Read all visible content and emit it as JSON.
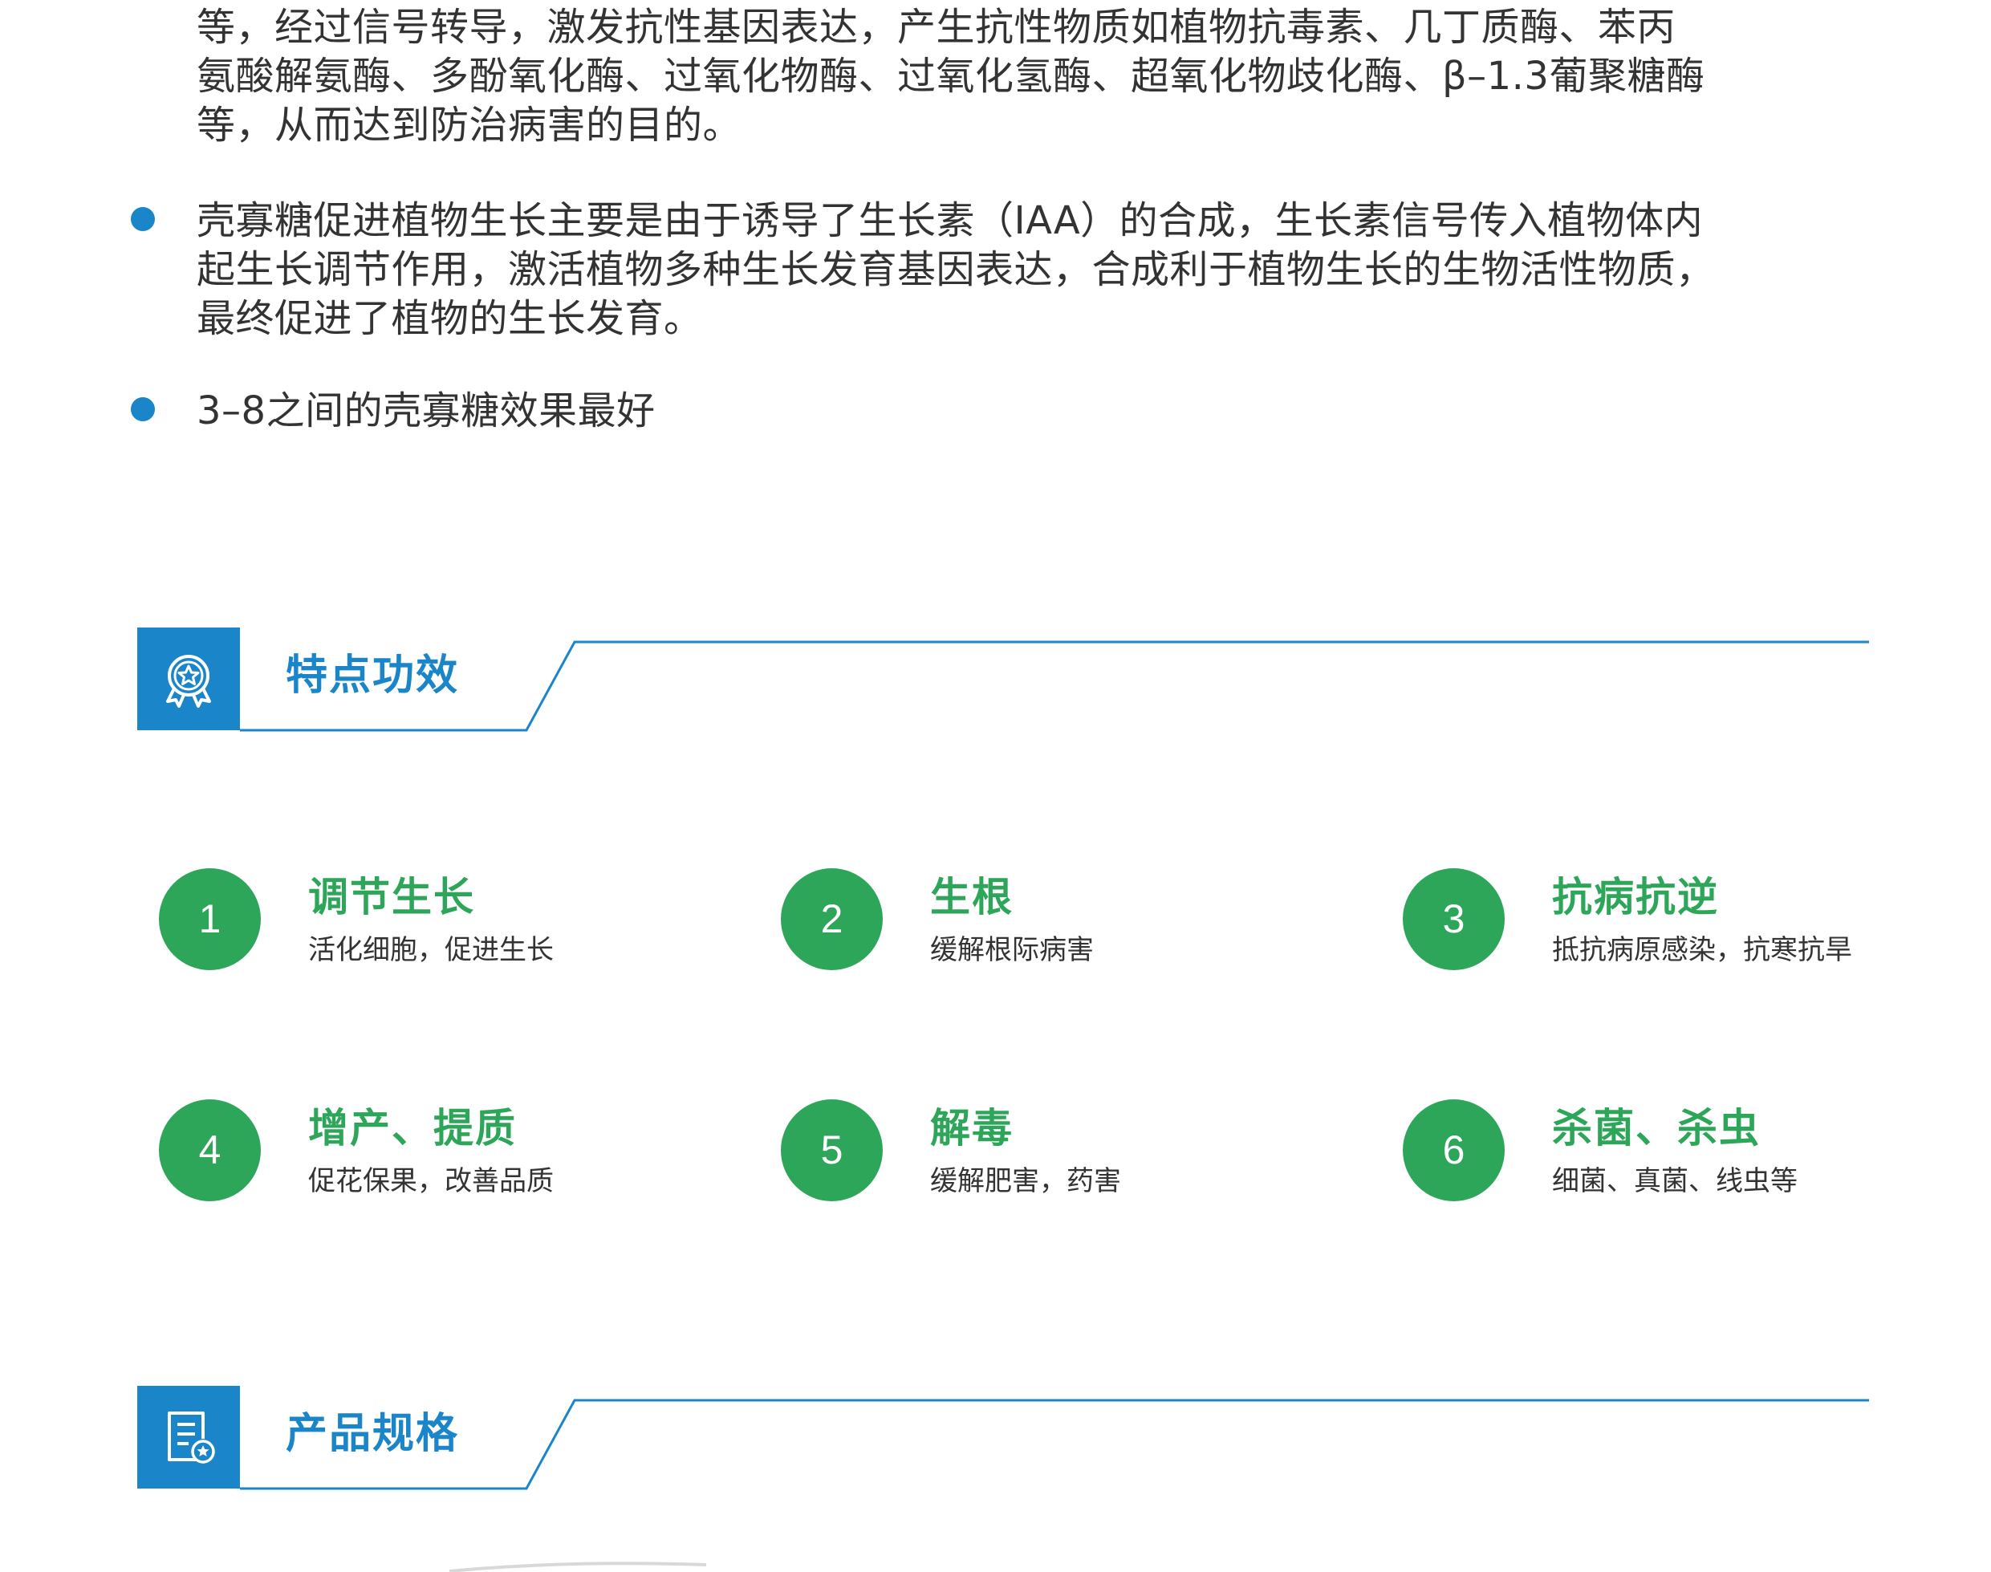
{
  "paragraphs": [
    {
      "lines": [
        "等，经过信号转导，激发抗性基因表达，产生抗性物质如植物抗毒素、几丁质酶、苯丙",
        "氨酸解氨酶、多酚氧化酶、过氧化物酶、过氧化氢酶、超氧化物歧化酶、β–1.3葡聚糖酶",
        "等，从而达到防治病害的目的。"
      ]
    },
    {
      "lines": [
        "壳寡糖促进植物生长主要是由于诱导了生长素（IAA）的合成，生长素信号传入植物体内",
        "起生长调节作用，激活植物多种生长发育基因表达，合成利于植物生长的生物活性物质，",
        "最终促进了植物的生长发育。"
      ]
    },
    {
      "lines": [
        "3–8之间的壳寡糖效果最好"
      ]
    }
  ],
  "sections": {
    "features": {
      "title": "特点功效",
      "icon": "award-star-icon"
    },
    "specs": {
      "title": "产品规格",
      "icon": "document-star-icon"
    }
  },
  "features": [
    {
      "number": "1",
      "title": "调节生长",
      "desc": "活化细胞，促进生长"
    },
    {
      "number": "2",
      "title": "生根",
      "desc": "缓解根际病害"
    },
    {
      "number": "3",
      "title": "抗病抗逆",
      "desc": "抵抗病原感染，抗寒抗旱"
    },
    {
      "number": "4",
      "title": "增产、提质",
      "desc": "促花保果，改善品质"
    },
    {
      "number": "5",
      "title": "解毒",
      "desc": "缓解肥害，药害"
    },
    {
      "number": "6",
      "title": "杀菌、杀虫",
      "desc": "细菌、真菌、线虫等"
    }
  ],
  "colors": {
    "accent_blue": "#1a85c8",
    "accent_green": "#2ea65a",
    "text": "#333333"
  }
}
